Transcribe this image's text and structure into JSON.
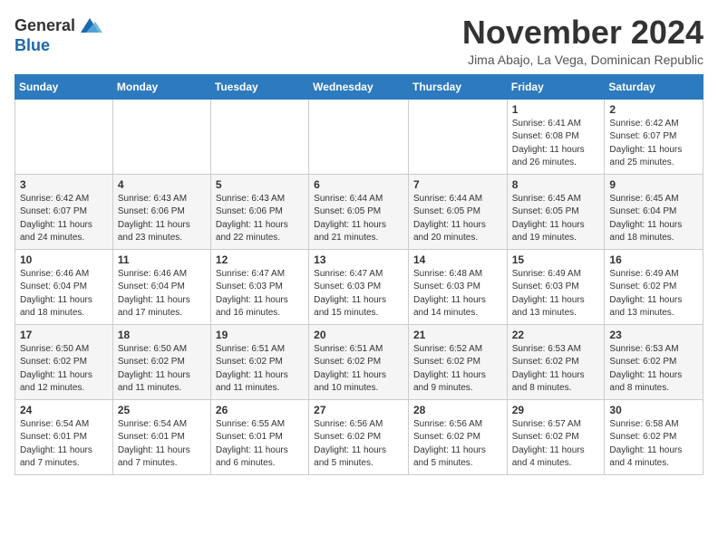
{
  "logo": {
    "general": "General",
    "blue": "Blue"
  },
  "header": {
    "month": "November 2024",
    "location": "Jima Abajo, La Vega, Dominican Republic"
  },
  "weekdays": [
    "Sunday",
    "Monday",
    "Tuesday",
    "Wednesday",
    "Thursday",
    "Friday",
    "Saturday"
  ],
  "weeks": [
    [
      {
        "day": "",
        "info": ""
      },
      {
        "day": "",
        "info": ""
      },
      {
        "day": "",
        "info": ""
      },
      {
        "day": "",
        "info": ""
      },
      {
        "day": "",
        "info": ""
      },
      {
        "day": "1",
        "info": "Sunrise: 6:41 AM\nSunset: 6:08 PM\nDaylight: 11 hours and 26 minutes."
      },
      {
        "day": "2",
        "info": "Sunrise: 6:42 AM\nSunset: 6:07 PM\nDaylight: 11 hours and 25 minutes."
      }
    ],
    [
      {
        "day": "3",
        "info": "Sunrise: 6:42 AM\nSunset: 6:07 PM\nDaylight: 11 hours and 24 minutes."
      },
      {
        "day": "4",
        "info": "Sunrise: 6:43 AM\nSunset: 6:06 PM\nDaylight: 11 hours and 23 minutes."
      },
      {
        "day": "5",
        "info": "Sunrise: 6:43 AM\nSunset: 6:06 PM\nDaylight: 11 hours and 22 minutes."
      },
      {
        "day": "6",
        "info": "Sunrise: 6:44 AM\nSunset: 6:05 PM\nDaylight: 11 hours and 21 minutes."
      },
      {
        "day": "7",
        "info": "Sunrise: 6:44 AM\nSunset: 6:05 PM\nDaylight: 11 hours and 20 minutes."
      },
      {
        "day": "8",
        "info": "Sunrise: 6:45 AM\nSunset: 6:05 PM\nDaylight: 11 hours and 19 minutes."
      },
      {
        "day": "9",
        "info": "Sunrise: 6:45 AM\nSunset: 6:04 PM\nDaylight: 11 hours and 18 minutes."
      }
    ],
    [
      {
        "day": "10",
        "info": "Sunrise: 6:46 AM\nSunset: 6:04 PM\nDaylight: 11 hours and 18 minutes."
      },
      {
        "day": "11",
        "info": "Sunrise: 6:46 AM\nSunset: 6:04 PM\nDaylight: 11 hours and 17 minutes."
      },
      {
        "day": "12",
        "info": "Sunrise: 6:47 AM\nSunset: 6:03 PM\nDaylight: 11 hours and 16 minutes."
      },
      {
        "day": "13",
        "info": "Sunrise: 6:47 AM\nSunset: 6:03 PM\nDaylight: 11 hours and 15 minutes."
      },
      {
        "day": "14",
        "info": "Sunrise: 6:48 AM\nSunset: 6:03 PM\nDaylight: 11 hours and 14 minutes."
      },
      {
        "day": "15",
        "info": "Sunrise: 6:49 AM\nSunset: 6:03 PM\nDaylight: 11 hours and 13 minutes."
      },
      {
        "day": "16",
        "info": "Sunrise: 6:49 AM\nSunset: 6:02 PM\nDaylight: 11 hours and 13 minutes."
      }
    ],
    [
      {
        "day": "17",
        "info": "Sunrise: 6:50 AM\nSunset: 6:02 PM\nDaylight: 11 hours and 12 minutes."
      },
      {
        "day": "18",
        "info": "Sunrise: 6:50 AM\nSunset: 6:02 PM\nDaylight: 11 hours and 11 minutes."
      },
      {
        "day": "19",
        "info": "Sunrise: 6:51 AM\nSunset: 6:02 PM\nDaylight: 11 hours and 11 minutes."
      },
      {
        "day": "20",
        "info": "Sunrise: 6:51 AM\nSunset: 6:02 PM\nDaylight: 11 hours and 10 minutes."
      },
      {
        "day": "21",
        "info": "Sunrise: 6:52 AM\nSunset: 6:02 PM\nDaylight: 11 hours and 9 minutes."
      },
      {
        "day": "22",
        "info": "Sunrise: 6:53 AM\nSunset: 6:02 PM\nDaylight: 11 hours and 8 minutes."
      },
      {
        "day": "23",
        "info": "Sunrise: 6:53 AM\nSunset: 6:02 PM\nDaylight: 11 hours and 8 minutes."
      }
    ],
    [
      {
        "day": "24",
        "info": "Sunrise: 6:54 AM\nSunset: 6:01 PM\nDaylight: 11 hours and 7 minutes."
      },
      {
        "day": "25",
        "info": "Sunrise: 6:54 AM\nSunset: 6:01 PM\nDaylight: 11 hours and 7 minutes."
      },
      {
        "day": "26",
        "info": "Sunrise: 6:55 AM\nSunset: 6:01 PM\nDaylight: 11 hours and 6 minutes."
      },
      {
        "day": "27",
        "info": "Sunrise: 6:56 AM\nSunset: 6:02 PM\nDaylight: 11 hours and 5 minutes."
      },
      {
        "day": "28",
        "info": "Sunrise: 6:56 AM\nSunset: 6:02 PM\nDaylight: 11 hours and 5 minutes."
      },
      {
        "day": "29",
        "info": "Sunrise: 6:57 AM\nSunset: 6:02 PM\nDaylight: 11 hours and 4 minutes."
      },
      {
        "day": "30",
        "info": "Sunrise: 6:58 AM\nSunset: 6:02 PM\nDaylight: 11 hours and 4 minutes."
      }
    ]
  ]
}
